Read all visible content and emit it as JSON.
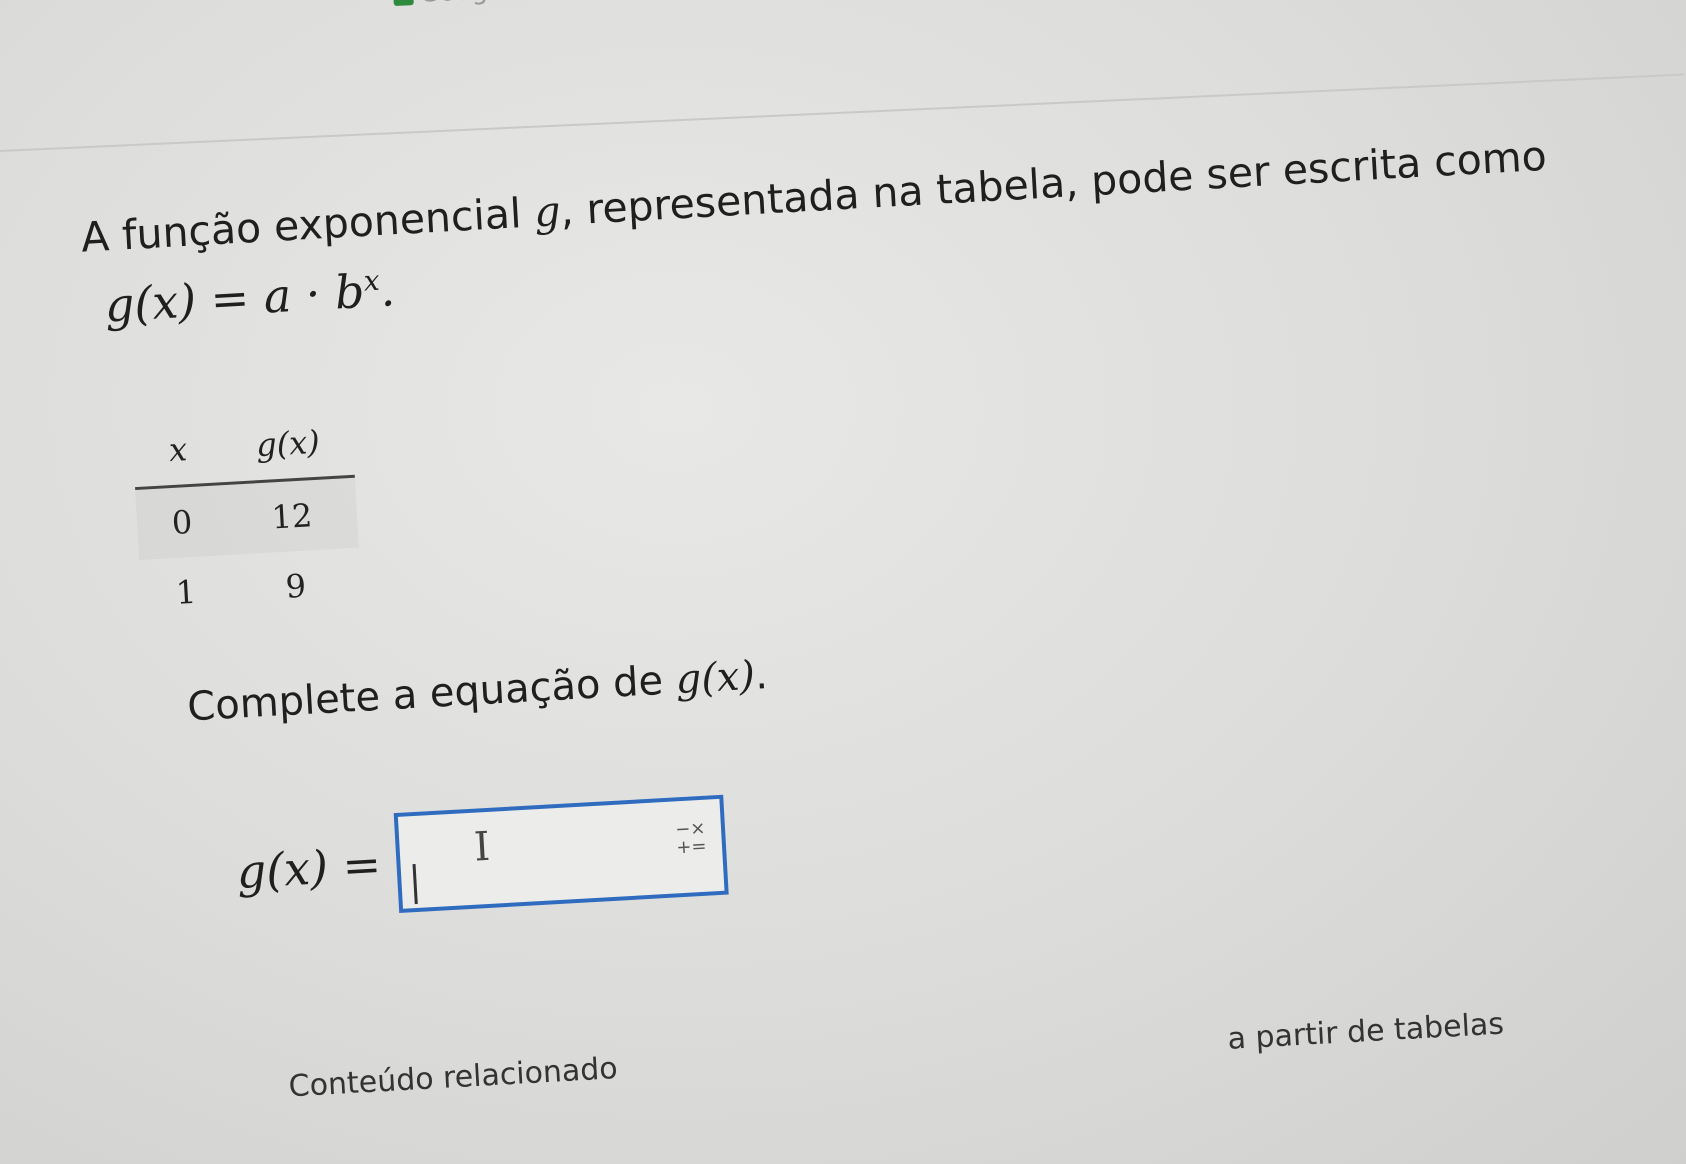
{
  "browser": {
    "tab_label": "Google"
  },
  "question": {
    "text_before": "A função exponencial ",
    "function_name": "g",
    "text_after": ", representada na tabela, pode ser escrita como",
    "formula": "g(x) = a · b",
    "formula_exponent": "x",
    "formula_end": "."
  },
  "table": {
    "headers": [
      "x",
      "g(x)"
    ],
    "rows": [
      [
        "0",
        "12"
      ],
      [
        "1",
        "9"
      ]
    ]
  },
  "instruction": {
    "text": "Complete a equação de ",
    "math": "g(x)",
    "end": "."
  },
  "answer": {
    "label": "g(x) =",
    "value": "",
    "cursor_icon": "I",
    "keypad_icon": "math-keypad-icon"
  },
  "footer": {
    "related_label": "Conteúdo relacionado",
    "related_link": "a partir de tabelas"
  }
}
